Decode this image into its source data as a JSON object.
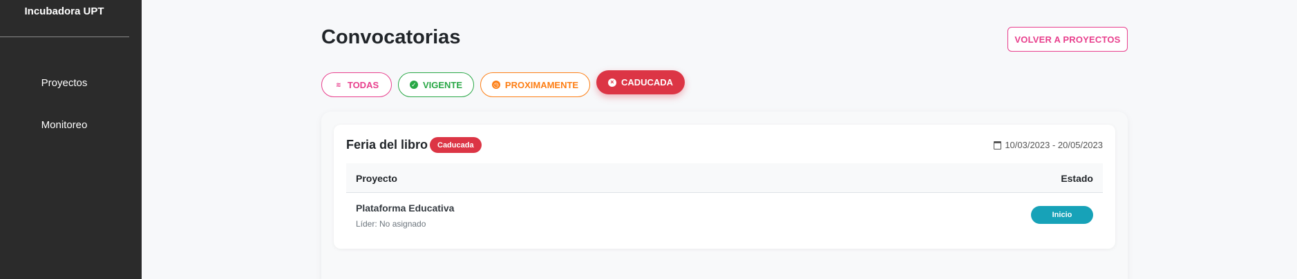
{
  "sidebar": {
    "brand": "Incubadora UPT",
    "items": [
      {
        "label": "Proyectos"
      },
      {
        "label": "Monitoreo"
      }
    ]
  },
  "header": {
    "title": "Convocatorias",
    "back_button": "VOLVER A PROYECTOS"
  },
  "filters": [
    {
      "label": "TODAS",
      "icon": "layers-icon",
      "color": "#e83e8c"
    },
    {
      "label": "VIGENTE",
      "icon": "check-circle-icon",
      "color": "#28a745"
    },
    {
      "label": "PROXIMAMENTE",
      "icon": "clock-icon",
      "color": "#fd7e14"
    },
    {
      "label": "CADUCADA",
      "icon": "x-circle-icon",
      "color": "#dc3545",
      "active": true
    }
  ],
  "convocatoria": {
    "title": "Feria del libro",
    "status": "Caducada",
    "dates": "10/03/2023 - 20/05/2023",
    "table": {
      "headers": [
        "Proyecto",
        "Estado"
      ],
      "rows": [
        {
          "name": "Plataforma Educativa",
          "leader": "Líder: No asignado",
          "estado": "Inicio"
        }
      ]
    }
  },
  "colors": {
    "sidebar": "#2b2b2b",
    "accent_pink": "#e83e8c",
    "danger": "#dc3545",
    "info": "#17a2b8"
  }
}
